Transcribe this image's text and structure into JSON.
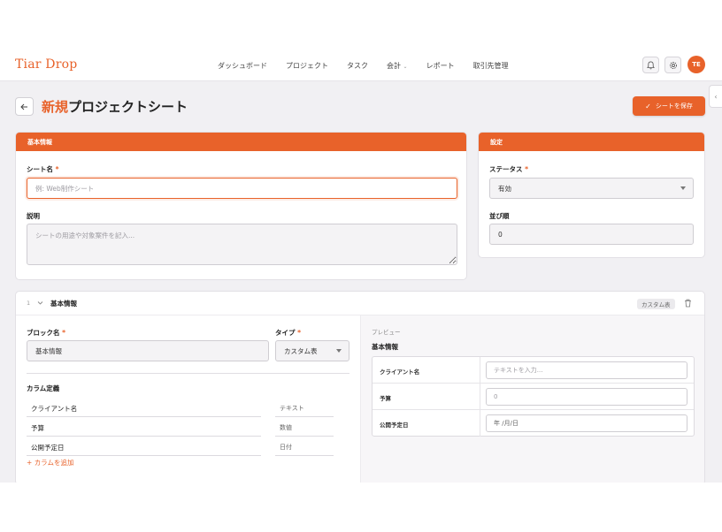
{
  "nav": {
    "logo": "Tiar Drop",
    "links": [
      "ダッシュボード",
      "プロジェクト",
      "タスク",
      "会計",
      "レポート",
      "取引先管理"
    ],
    "account_caret": "⌄",
    "bell_icon": "bell-icon",
    "settings_icon": "gear-icon",
    "avatar_initials": "TE"
  },
  "page": {
    "title_accent": "新規",
    "title_rest": "プロジェクトシート",
    "save_label": "シートを保存",
    "sidebar_toggle": "‹"
  },
  "basic_info": {
    "header": "基本情報",
    "sheet_name_label": "シート名",
    "sheet_name_placeholder": "例: Web制作シート",
    "description_label": "説明",
    "description_placeholder": "シートの用途や対象案件を記入..."
  },
  "settings": {
    "header": "設定",
    "status_label": "ステータス",
    "status_value": "有効",
    "order_label": "並び順",
    "order_value": "0"
  },
  "required_mark": "*",
  "block": {
    "index": "1",
    "title": "基本情報",
    "tag": "カスタム表",
    "block_name_label": "ブロック名",
    "block_name_value": "基本情報",
    "type_label": "タイプ",
    "type_value": "カスタム表",
    "columns_label": "カラム定義",
    "columns": [
      {
        "name": "クライアント名",
        "type": "テキスト"
      },
      {
        "name": "予算",
        "type": "数値"
      },
      {
        "name": "公開予定日",
        "type": "日付"
      }
    ],
    "add_column_label": "カラムを追加",
    "preview": {
      "label": "プレビュー",
      "title": "基本情報",
      "rows": [
        {
          "label": "クライアント名",
          "placeholder": "テキストを入力..."
        },
        {
          "label": "予算",
          "placeholder": "0"
        },
        {
          "label": "公開予定日",
          "placeholder": "年 /月/日"
        }
      ]
    }
  },
  "colors": {
    "accent": "#e8622a",
    "background": "#f1f0f3"
  }
}
